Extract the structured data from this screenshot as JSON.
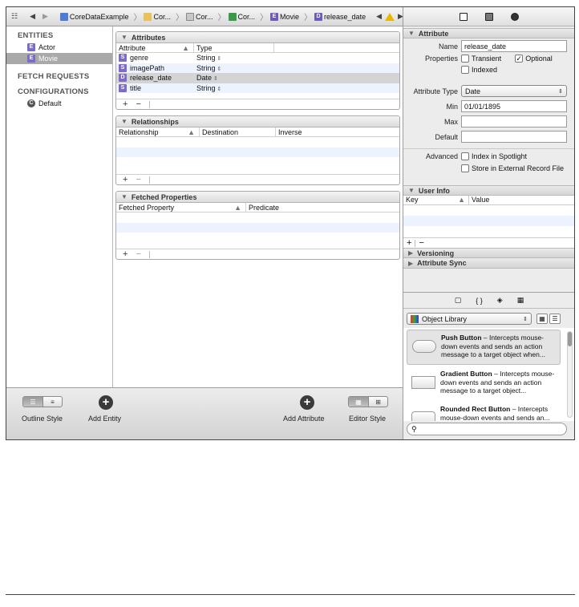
{
  "jumpbar": {
    "back": "◀",
    "forward": "▶",
    "crumbs": [
      "CoreDataExample",
      "Cor...",
      "Cor...",
      "Cor...",
      "Movie",
      "release_date"
    ],
    "nav_prev": "◀",
    "nav_next": "▶"
  },
  "sidebar": {
    "entities_header": "ENTITIES",
    "entities": [
      {
        "badge": "E",
        "label": "Actor"
      },
      {
        "badge": "E",
        "label": "Movie"
      }
    ],
    "fetch_header": "FETCH REQUESTS",
    "configs_header": "CONFIGURATIONS",
    "configs": [
      {
        "badge": "C",
        "label": "Default"
      }
    ]
  },
  "attributes_panel": {
    "title": "Attributes",
    "col_attribute": "Attribute",
    "col_type": "Type",
    "rows": [
      {
        "badge": "S",
        "name": "genre",
        "type": "String"
      },
      {
        "badge": "S",
        "name": "imagePath",
        "type": "String"
      },
      {
        "badge": "D",
        "name": "release_date",
        "type": "Date"
      },
      {
        "badge": "S",
        "name": "title",
        "type": "String"
      }
    ],
    "add": "+",
    "remove": "−"
  },
  "relationships_panel": {
    "title": "Relationships",
    "col_relationship": "Relationship",
    "col_destination": "Destination",
    "col_inverse": "Inverse",
    "add": "+",
    "remove": "−"
  },
  "fetched_panel": {
    "title": "Fetched Properties",
    "col_property": "Fetched Property",
    "col_predicate": "Predicate",
    "add": "+",
    "remove": "−"
  },
  "bottombar": {
    "outline_style": "Outline Style",
    "add_entity": "Add Entity",
    "add_attribute": "Add Attribute",
    "editor_style": "Editor Style",
    "plus": "+"
  },
  "inspector": {
    "attribute_header": "Attribute",
    "name_label": "Name",
    "name_value": "release_date",
    "properties_label": "Properties",
    "transient_label": "Transient",
    "optional_label": "Optional",
    "indexed_label": "Indexed",
    "attribute_type_label": "Attribute Type",
    "attribute_type_value": "Date",
    "min_label": "Min",
    "min_value": "01/01/1895",
    "max_label": "Max",
    "max_value": "",
    "default_label": "Default",
    "default_value": "",
    "advanced_label": "Advanced",
    "index_spotlight_label": "Index in Spotlight",
    "external_record_label": "Store in External Record File",
    "user_info_header": "User Info",
    "col_key": "Key",
    "col_value": "Value",
    "versioning_header": "Versioning",
    "attribute_sync_header": "Attribute Sync",
    "library_tab_glyphs": [
      "▢",
      "{ }",
      "◈",
      "▦"
    ],
    "library_popup": "Object Library",
    "library_items": [
      {
        "title": "Push Button",
        "desc": " – Intercepts mouse-down events and sends an action message to a target object when..."
      },
      {
        "title": "Gradient Button",
        "desc": " – Intercepts mouse-down events and sends an action message to a target object..."
      },
      {
        "title": "Rounded Rect Button",
        "desc": " – Intercepts mouse-down events and sends an..."
      }
    ],
    "search_placeholder": ""
  }
}
